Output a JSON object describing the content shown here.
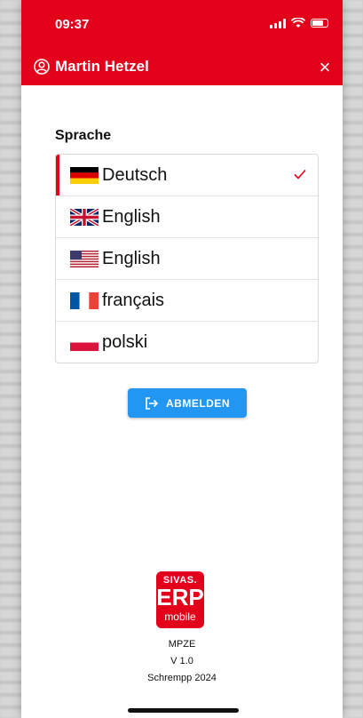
{
  "status_bar": {
    "time": "09:37"
  },
  "header": {
    "user_name": "Martin Hetzel",
    "close_label": "×"
  },
  "language": {
    "title": "Sprache",
    "items": [
      {
        "label": "Deutsch",
        "flag": "flag-de-icon",
        "selected": true
      },
      {
        "label": "English",
        "flag": "flag-uk-icon",
        "selected": false
      },
      {
        "label": "English",
        "flag": "flag-us-icon",
        "selected": false
      },
      {
        "label": "français",
        "flag": "flag-fr-icon",
        "selected": false
      },
      {
        "label": "polski",
        "flag": "flag-pl-icon",
        "selected": false
      }
    ]
  },
  "logout": {
    "label": "ABMELDEN"
  },
  "footer": {
    "logo_line1": "SIVAS.",
    "logo_line2": "ERP",
    "logo_line3": "mobile",
    "app_name": "MPZE",
    "version": "V 1.0",
    "copyright": "Schrempp 2024"
  },
  "colors": {
    "brand": "#e2001a",
    "button": "#2196f3"
  }
}
